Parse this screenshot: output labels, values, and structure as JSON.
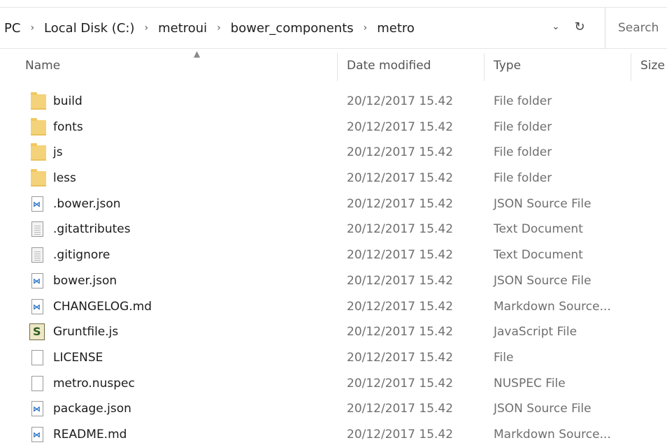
{
  "address": {
    "crumbs": [
      "PC",
      "Local Disk (C:)",
      "metroui",
      "bower_components",
      "metro"
    ],
    "dropdown_icon": "chevron-down-icon",
    "refresh_icon": "refresh-icon"
  },
  "search": {
    "placeholder": "Search"
  },
  "columns": {
    "name": "Name",
    "date": "Date modified",
    "type": "Type",
    "size": "Size"
  },
  "files": [
    {
      "name": "build",
      "date": "20/12/2017 15.42",
      "type": "File folder",
      "icon": "folder-icon"
    },
    {
      "name": "fonts",
      "date": "20/12/2017 15.42",
      "type": "File folder",
      "icon": "folder-icon"
    },
    {
      "name": "js",
      "date": "20/12/2017 15.42",
      "type": "File folder",
      "icon": "folder-icon"
    },
    {
      "name": "less",
      "date": "20/12/2017 15.42",
      "type": "File folder",
      "icon": "folder-icon"
    },
    {
      "name": ".bower.json",
      "date": "20/12/2017 15.42",
      "type": "JSON Source File",
      "icon": "vscode-file-icon"
    },
    {
      "name": ".gitattributes",
      "date": "20/12/2017 15.42",
      "type": "Text Document",
      "icon": "text-document-icon"
    },
    {
      "name": ".gitignore",
      "date": "20/12/2017 15.42",
      "type": "Text Document",
      "icon": "text-document-icon"
    },
    {
      "name": "bower.json",
      "date": "20/12/2017 15.42",
      "type": "JSON Source File",
      "icon": "vscode-file-icon"
    },
    {
      "name": "CHANGELOG.md",
      "date": "20/12/2017 15.42",
      "type": "Markdown Source...",
      "icon": "vscode-file-icon"
    },
    {
      "name": "Gruntfile.js",
      "date": "20/12/2017 15.42",
      "type": "JavaScript File",
      "icon": "script-file-icon"
    },
    {
      "name": "LICENSE",
      "date": "20/12/2017 15.42",
      "type": "File",
      "icon": "blank-file-icon"
    },
    {
      "name": "metro.nuspec",
      "date": "20/12/2017 15.42",
      "type": "NUSPEC File",
      "icon": "blank-file-icon"
    },
    {
      "name": "package.json",
      "date": "20/12/2017 15.42",
      "type": "JSON Source File",
      "icon": "vscode-file-icon"
    },
    {
      "name": "README.md",
      "date": "20/12/2017 15.42",
      "type": "Markdown Source...",
      "icon": "vscode-file-icon"
    }
  ]
}
